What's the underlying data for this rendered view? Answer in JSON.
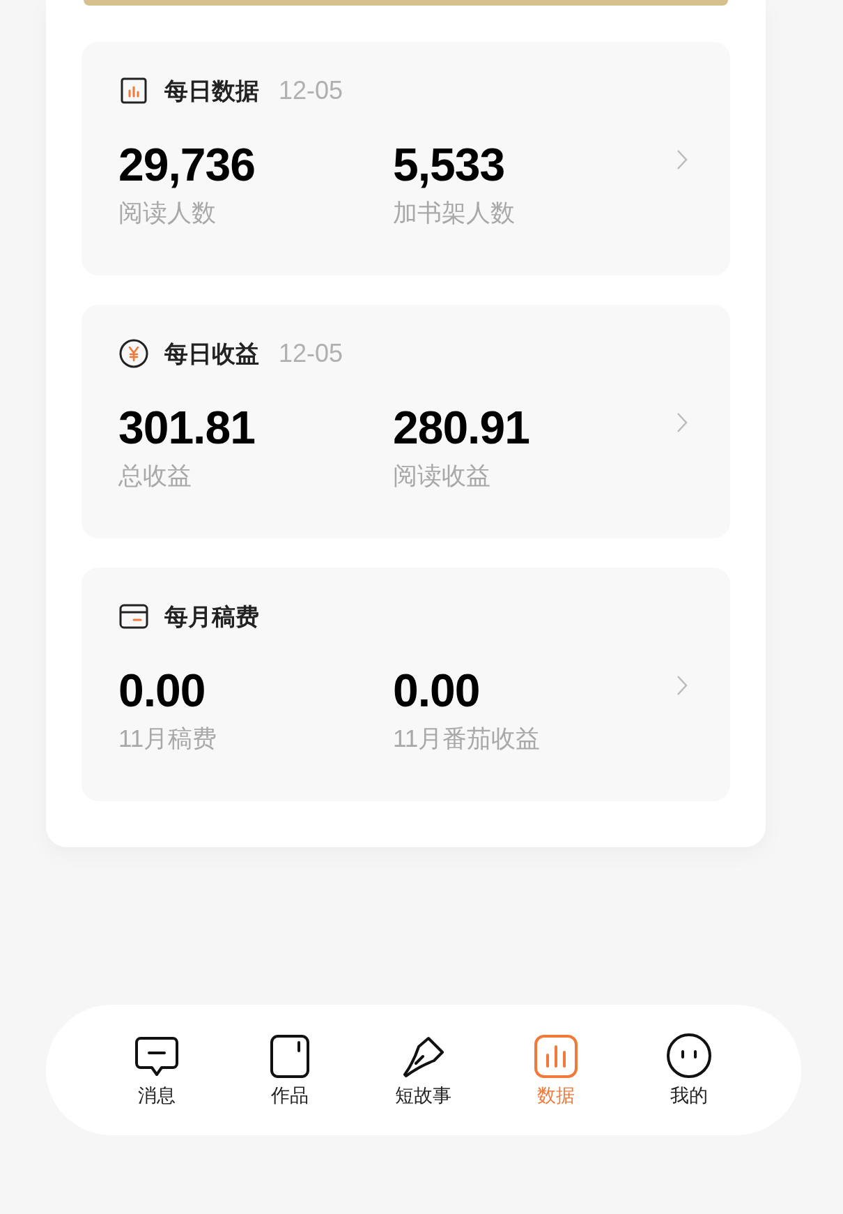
{
  "sections": [
    {
      "kind": "chart",
      "title": "每日数据",
      "date": "12-05",
      "stats": [
        {
          "value": "29,736",
          "label": "阅读人数"
        },
        {
          "value": "5,533",
          "label": "加书架人数"
        }
      ]
    },
    {
      "kind": "coin",
      "title": "每日收益",
      "date": "12-05",
      "stats": [
        {
          "value": "301.81",
          "label": "总收益"
        },
        {
          "value": "280.91",
          "label": "阅读收益"
        }
      ]
    },
    {
      "kind": "card",
      "title": "每月稿费",
      "stats": [
        {
          "value": "0.00",
          "label": "11月稿费"
        },
        {
          "value": "0.00",
          "label": "11月番茄收益"
        }
      ]
    }
  ],
  "nav": [
    {
      "kind": "message",
      "label": "消息",
      "selected": false
    },
    {
      "kind": "works",
      "label": "作品",
      "selected": false
    },
    {
      "kind": "pen",
      "label": "短故事",
      "selected": false
    },
    {
      "kind": "chart",
      "label": "数据",
      "selected": true
    },
    {
      "kind": "face",
      "label": "我的",
      "selected": false
    }
  ]
}
